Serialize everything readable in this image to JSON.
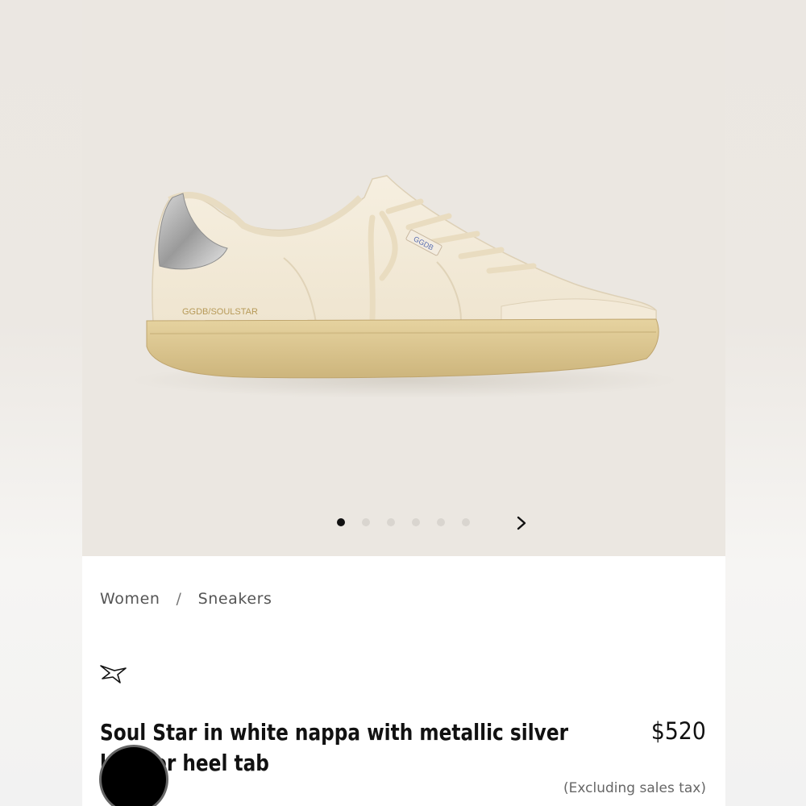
{
  "gallery": {
    "slide_count": 6,
    "active_slide": 1,
    "shoe_branding": {
      "heel_text": "GGDB/SOULSTAR",
      "tab_text": "GGDB"
    }
  },
  "breadcrumb": {
    "items": [
      "Women",
      "Sneakers"
    ],
    "separator": "/"
  },
  "product": {
    "title": "Soul Star in white nappa with metallic silver leather heel tab",
    "price": "$520",
    "tax_note": "(Excluding sales tax)"
  },
  "colors": {
    "gallery_bg": "#ebe7e1",
    "dot_active": "#111111",
    "dot_inactive": "#d9d5cf"
  },
  "icons": {
    "wishlist": "star-outline-icon",
    "next": "chevron-right-icon"
  }
}
